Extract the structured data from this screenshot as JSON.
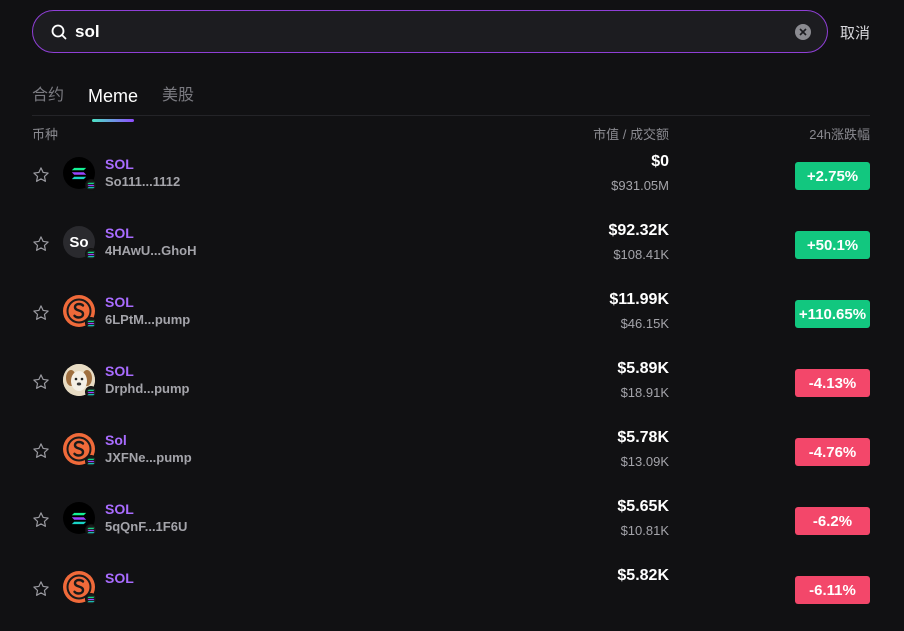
{
  "search": {
    "value": "sol",
    "cancel_label": "取消"
  },
  "tabs": [
    {
      "label": "合约",
      "active": false
    },
    {
      "label": "Meme",
      "active": true
    },
    {
      "label": "美股",
      "active": false
    }
  ],
  "columns": {
    "coin": "币种",
    "mcap_vol": "市值 / 成交额",
    "change": "24h涨跌幅"
  },
  "colors": {
    "accent": "#8f3fd6",
    "name": "#a96cff",
    "up": "#12c77f",
    "down": "#f3476a"
  },
  "rows": [
    {
      "name": "SOL",
      "address": "So111...1112",
      "mcap": "$0",
      "volume": "$931.05M",
      "change": "+2.75%",
      "dir": "up",
      "logo": "solana-logo"
    },
    {
      "name": "SOL",
      "address": "4HAwU...GhoH",
      "mcap": "$92.32K",
      "volume": "$108.41K",
      "change": "+50.1%",
      "dir": "up",
      "logo": "so-text-logo",
      "logo_text": "So"
    },
    {
      "name": "SOL",
      "address": "6LPtM...pump",
      "mcap": "$11.99K",
      "volume": "$46.15K",
      "change": "+110.65%",
      "dir": "up",
      "logo": "s-coin-logo"
    },
    {
      "name": "SOL",
      "address": "Drphd...pump",
      "mcap": "$5.89K",
      "volume": "$18.91K",
      "change": "-4.13%",
      "dir": "down",
      "logo": "dog-logo"
    },
    {
      "name": "Sol",
      "address": "JXFNe...pump",
      "mcap": "$5.78K",
      "volume": "$13.09K",
      "change": "-4.76%",
      "dir": "down",
      "logo": "s-coin-logo"
    },
    {
      "name": "SOL",
      "address": "5qQnF...1F6U",
      "mcap": "$5.65K",
      "volume": "$10.81K",
      "change": "-6.2%",
      "dir": "down",
      "logo": "solana-logo"
    },
    {
      "name": "SOL",
      "address": "",
      "mcap": "$5.82K",
      "volume": "",
      "change": "-6.11%",
      "dir": "down",
      "logo": "s-coin-logo"
    }
  ]
}
